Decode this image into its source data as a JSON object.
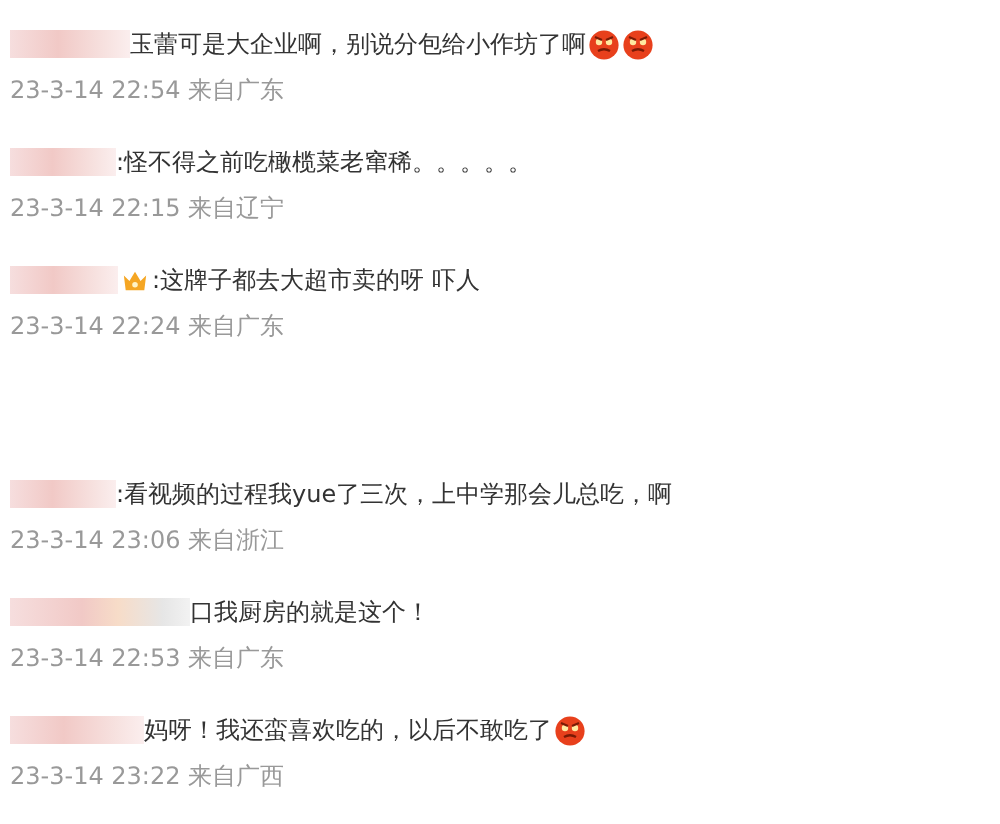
{
  "comments": [
    {
      "text": "玉蕾可是大企业啊，别说分包给小作坊了啊",
      "emojis": [
        {
          "kind": "angry-face"
        },
        {
          "kind": "angry-face"
        }
      ],
      "meta": "23-3-14 22:54 来自广东"
    },
    {
      "text": ":怪不得之前吃橄榄菜老窜稀。。。。。",
      "meta": "23-3-14 22:15 来自辽宁"
    },
    {
      "text": ":这牌子都去大超市卖的呀 吓人",
      "badges": [
        {
          "kind": "crown"
        }
      ],
      "meta": "23-3-14 22:24 来自广东"
    },
    {
      "text": ":看视频的过程我yue了三次，上中学那会儿总吃，啊",
      "meta": "23-3-14 23:06 来自浙江"
    },
    {
      "text": "口我厨房的就是这个！",
      "meta": "23-3-14 22:53 来自广东"
    },
    {
      "text": "妈呀！我还蛮喜欢吃的，以后不敢吃了",
      "emojis": [
        {
          "kind": "angry-face"
        }
      ],
      "meta": "23-3-14 23:22 来自广西"
    }
  ]
}
